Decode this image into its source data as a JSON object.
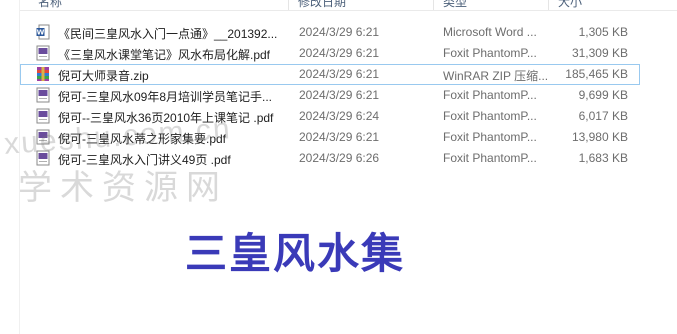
{
  "columns": {
    "name": "名称",
    "date": "修改日期",
    "type": "类型",
    "size": "大小"
  },
  "files": [
    {
      "name": "《民间三皇风水入门一点通》__201392...",
      "date": "2024/3/29 6:21",
      "type": "Microsoft Word ...",
      "size": "1,305 KB",
      "icon": "word-doc-icon"
    },
    {
      "name": "《三皇风水课堂笔记》风水布局化解.pdf",
      "date": "2024/3/29 6:21",
      "type": "Foxit PhantomP...",
      "size": "31,309 KB",
      "icon": "pdf-file-icon"
    },
    {
      "name": "倪可大师录音.zip",
      "date": "2024/3/29 6:21",
      "type": "WinRAR ZIP 压缩...",
      "size": "185,465 KB",
      "icon": "zip-archive-icon"
    },
    {
      "name": "倪可-三皇风水09年8月培训学员笔记手...",
      "date": "2024/3/29 6:21",
      "type": "Foxit PhantomP...",
      "size": "9,699 KB",
      "icon": "pdf-file-icon"
    },
    {
      "name": "倪可--三皇风水36页2010年上课笔记 .pdf",
      "date": "2024/3/29 6:24",
      "type": "Foxit PhantomP...",
      "size": "6,017 KB",
      "icon": "pdf-file-icon"
    },
    {
      "name": "倪可-三皇风水蒂之形家集要.pdf",
      "date": "2024/3/29 6:21",
      "type": "Foxit PhantomP...",
      "size": "13,980 KB",
      "icon": "pdf-file-icon"
    },
    {
      "name": "倪可-三皇风水入门讲义49页 .pdf",
      "date": "2024/3/29 6:26",
      "type": "Foxit PhantomP...",
      "size": "1,683 KB",
      "icon": "pdf-file-icon"
    }
  ],
  "watermark": {
    "latin": "xueshu.com.cn",
    "chinese": "学术资源网"
  },
  "overlay_title": "三皇风水集",
  "colors": {
    "overlay_title": "#3a3ab8",
    "selection_border": "#99c9ef",
    "header_text": "#4c607a"
  }
}
